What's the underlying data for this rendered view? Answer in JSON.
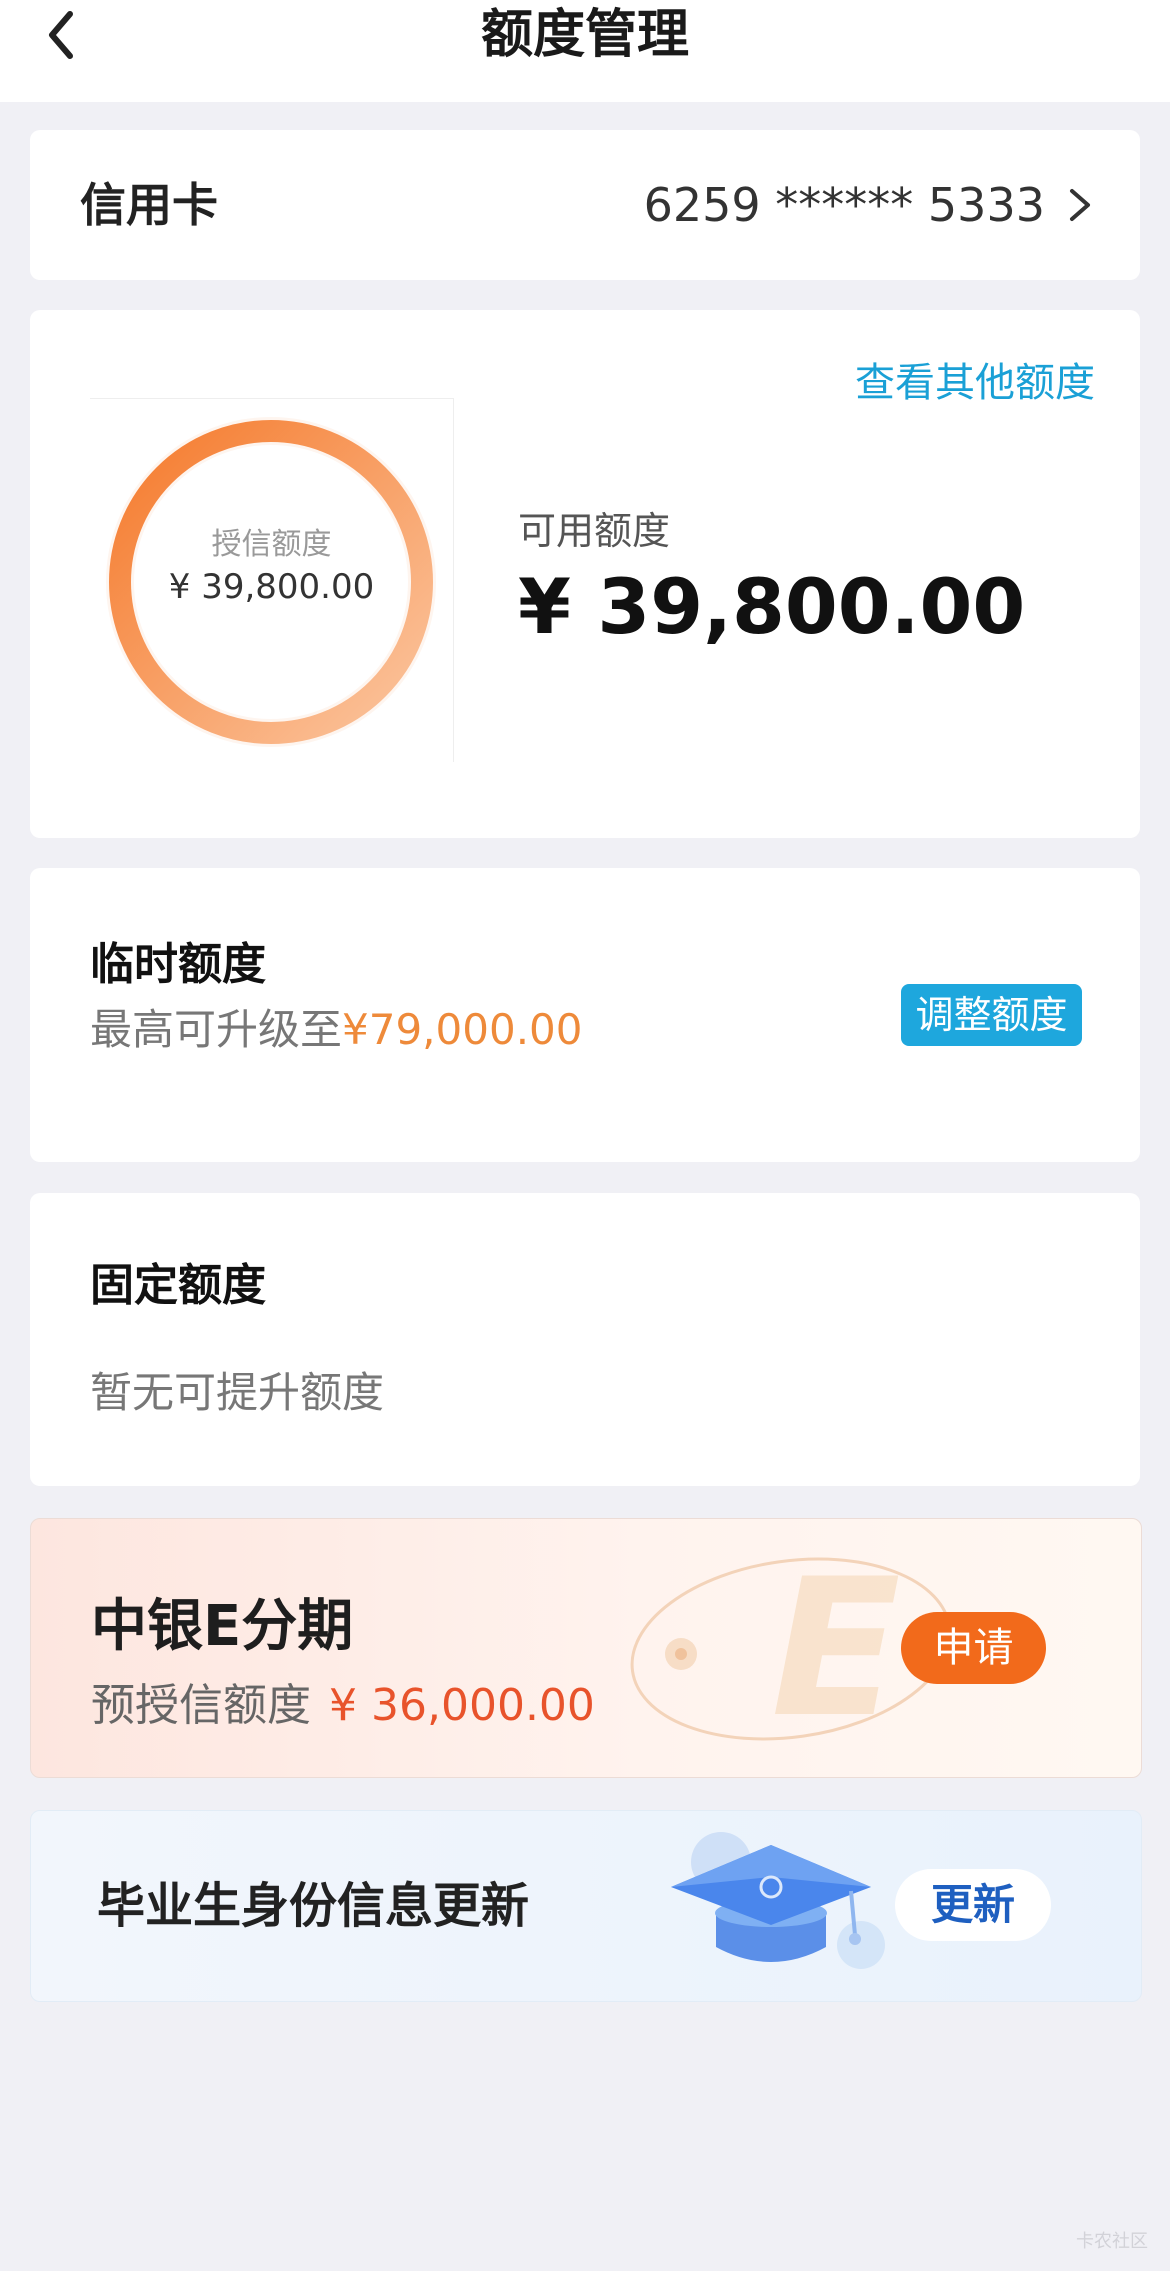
{
  "nav": {
    "title": "额度管理",
    "back_icon": "chevron-left-icon"
  },
  "card_selector": {
    "label": "信用卡",
    "card_number": "6259 ****** 5333",
    "chevron_icon": "chevron-right-icon"
  },
  "credit_limit": {
    "other_link": "查看其他额度",
    "ring_label": "授信额度",
    "ring_value": "¥ 39,800.00",
    "available_label": "可用额度",
    "available_value": "¥ 39,800.00",
    "ring_color": "#f5873a"
  },
  "temp_limit": {
    "title": "临时额度",
    "desc_prefix": "最高可升级至",
    "max_amount": "¥79,000.00",
    "button": "调整额度"
  },
  "fixed_limit": {
    "title": "固定额度",
    "desc": "暂无可提升额度"
  },
  "promo": {
    "title": "中银E分期",
    "sub_label": "预授信额度",
    "amount": "¥ 36,000.00",
    "button": "申请",
    "art_letter": "E"
  },
  "graduate": {
    "text": "毕业生身份信息更新",
    "button": "更新",
    "art_icon": "graduation-cap-icon"
  },
  "watermark": "卡农社区"
}
